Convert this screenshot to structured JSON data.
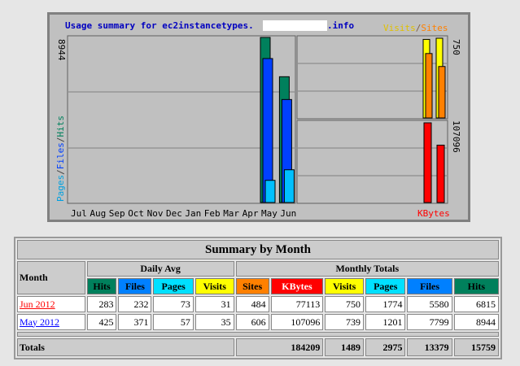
{
  "chart": {
    "title": "Usage summary for ec2instancetypes.",
    "title_suffix": ".info",
    "left_axis_label": "Pages / Files / Hits",
    "left_axis_max": "8944",
    "legend_right_top": "Visits / Sites",
    "right_top_max": "750",
    "right_bottom_max": "107096",
    "kbytes_label": "KBytes",
    "months": [
      "Jul",
      "Aug",
      "Sep",
      "Oct",
      "Nov",
      "Dec",
      "Jan",
      "Feb",
      "Mar",
      "Apr",
      "May",
      "Jun"
    ]
  },
  "chart_data": {
    "type": "bar",
    "categories": [
      "Jul",
      "Aug",
      "Sep",
      "Oct",
      "Nov",
      "Dec",
      "Jan",
      "Feb",
      "Mar",
      "Apr",
      "May",
      "Jun"
    ],
    "series": [
      {
        "name": "Hits",
        "values": [
          0,
          0,
          0,
          0,
          0,
          0,
          0,
          0,
          0,
          0,
          8944,
          6815
        ]
      },
      {
        "name": "Files",
        "values": [
          0,
          0,
          0,
          0,
          0,
          0,
          0,
          0,
          0,
          0,
          7799,
          5580
        ]
      },
      {
        "name": "Pages",
        "values": [
          0,
          0,
          0,
          0,
          0,
          0,
          0,
          0,
          0,
          0,
          1201,
          1774
        ]
      },
      {
        "name": "Visits",
        "values": [
          0,
          0,
          0,
          0,
          0,
          0,
          0,
          0,
          0,
          0,
          739,
          750
        ]
      },
      {
        "name": "Sites",
        "values": [
          0,
          0,
          0,
          0,
          0,
          0,
          0,
          0,
          0,
          0,
          606,
          484
        ]
      },
      {
        "name": "KBytes",
        "values": [
          0,
          0,
          0,
          0,
          0,
          0,
          0,
          0,
          0,
          0,
          107096,
          77113
        ]
      }
    ],
    "left_ylim": [
      0,
      8944
    ],
    "right_top_ylim": [
      0,
      750
    ],
    "right_bottom_ylim": [
      0,
      107096
    ]
  },
  "colors": {
    "hits": "#00805c",
    "files": "#0040ff",
    "pages": "#00c0ff",
    "visits": "#ffff00",
    "sites": "#ff8000",
    "kbytes": "#ff0000"
  },
  "table": {
    "title": "Summary by Month",
    "month_header": "Month",
    "daily_avg": "Daily Avg",
    "monthly_totals": "Monthly Totals",
    "daily_cols": [
      "Hits",
      "Files",
      "Pages",
      "Visits"
    ],
    "monthly_cols": [
      "Sites",
      "KBytes",
      "Visits",
      "Pages",
      "Files",
      "Hits"
    ],
    "rows": [
      {
        "month": "Jun 2012",
        "daily": [
          "283",
          "232",
          "73",
          "31"
        ],
        "monthly": [
          "484",
          "77113",
          "750",
          "1774",
          "5580",
          "6815"
        ]
      },
      {
        "month": "May 2012",
        "daily": [
          "425",
          "371",
          "57",
          "35"
        ],
        "monthly": [
          "606",
          "107096",
          "739",
          "1201",
          "7799",
          "8944"
        ]
      }
    ],
    "totals_label": "Totals",
    "totals": [
      "184209",
      "1489",
      "2975",
      "13379",
      "15759"
    ]
  }
}
